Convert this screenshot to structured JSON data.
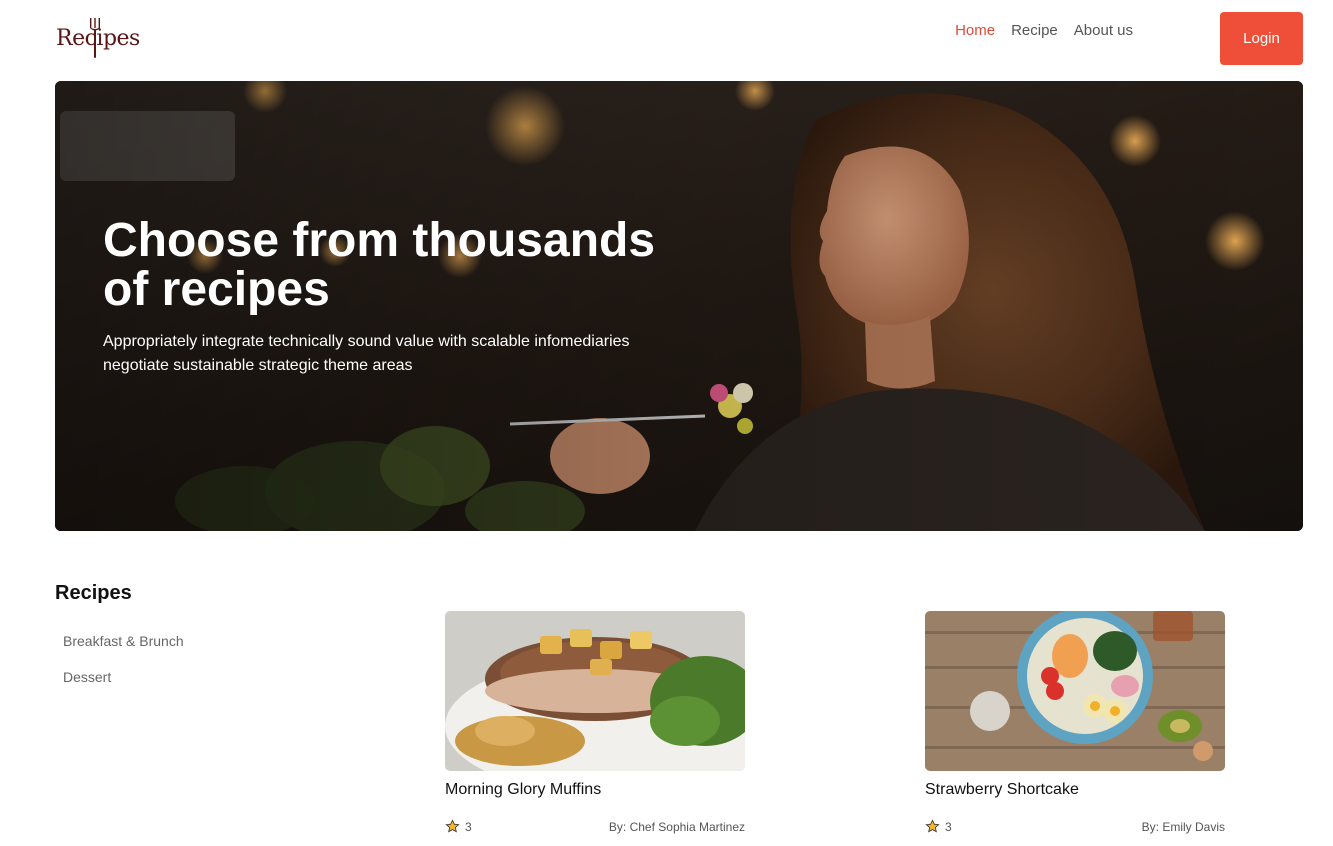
{
  "brand": {
    "logo_text": "Recipes"
  },
  "nav": {
    "items": [
      {
        "label": "Home",
        "active": true
      },
      {
        "label": "Recipe",
        "active": false
      },
      {
        "label": "About us",
        "active": false
      }
    ],
    "login_label": "Login"
  },
  "hero": {
    "title": "Choose from thousands of recipes",
    "subtitle": "Appropriately integrate technically sound value with scalable infomediaries negotiate sustainable strategic theme areas"
  },
  "recipes": {
    "heading": "Recipes",
    "categories": [
      "Breakfast & Brunch",
      "Dessert"
    ],
    "cards": [
      {
        "title": "Morning Glory Muffins",
        "rating": "3",
        "author": "By: Chef Sophia Martinez"
      },
      {
        "title": "Strawberry Shortcake",
        "rating": "3",
        "author": "By: Emily Davis"
      }
    ]
  },
  "colors": {
    "accent": "#ef4f38",
    "nav_active": "#e04a36",
    "logo": "#5a1616"
  },
  "icons": [
    "fork-icon",
    "star-icon"
  ]
}
